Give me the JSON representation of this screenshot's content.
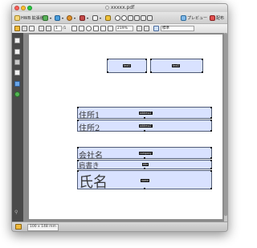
{
  "window": {
    "title": "○ xxxxx.pdf"
  },
  "toolbar": {
    "items": [
      {
        "label": "HWB 拡張版"
      },
      {
        "label": ""
      },
      {
        "label": ""
      },
      {
        "label": ""
      },
      {
        "label": ""
      },
      {
        "label": ""
      },
      {
        "label": "プレビュー"
      },
      {
        "label": "配布"
      }
    ]
  },
  "subtoolbar": {
    "page_field": "1",
    "page_total": "/1",
    "zoom": "219%",
    "style": "標準"
  },
  "form_fields": [
    {
      "label": "",
      "tag": "text1"
    },
    {
      "label": "",
      "tag": "text2"
    },
    {
      "label": "住所1",
      "tag": "address1"
    },
    {
      "label": "住所2",
      "tag": "address2"
    },
    {
      "label": "会社名",
      "tag": "company"
    },
    {
      "label": "肩書き",
      "tag": "title"
    },
    {
      "label": "氏名",
      "tag": "name"
    }
  ],
  "statusbar": {
    "size": "100 x 148 mm"
  },
  "colors": {
    "field_fill": "#d9e2ff",
    "field_border": "#4e5a75",
    "sidebar": "#4a4a4a",
    "doc_background": "#8a8a8a"
  },
  "icons": {
    "sidebar": [
      "pages-icon",
      "bookmark-icon",
      "attachment-icon",
      "signature-icon",
      "layers-icon",
      "info-icon",
      "search-icon"
    ]
  }
}
